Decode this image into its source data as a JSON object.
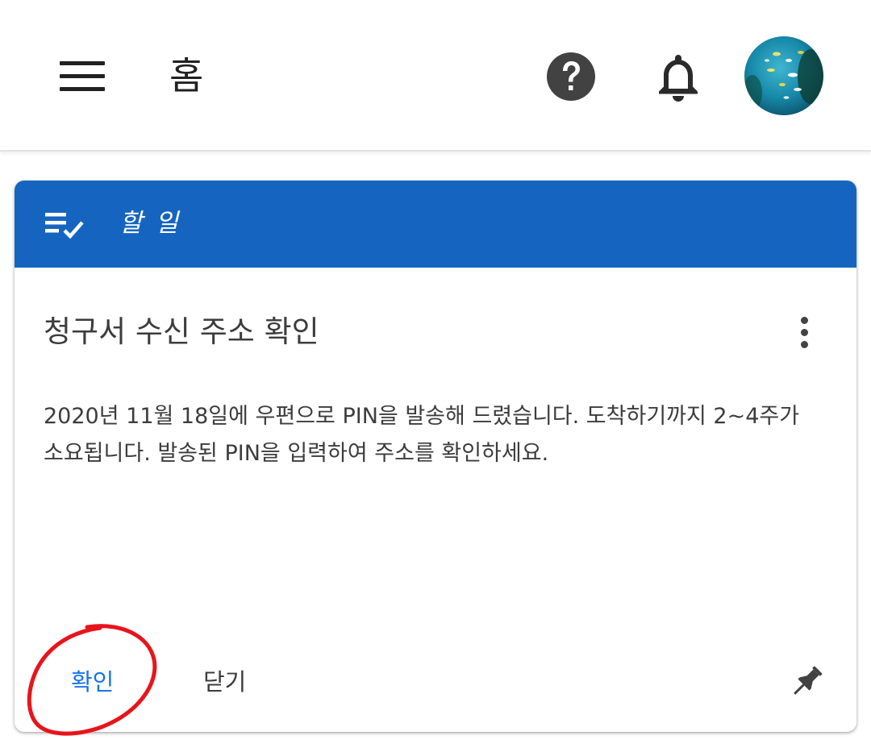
{
  "header": {
    "title": "홈",
    "icons": {
      "menu": "menu-icon",
      "help": "help-circle-icon",
      "notifications": "bell-icon",
      "avatar": "profile-avatar"
    }
  },
  "card": {
    "header_label": "할 일",
    "header_icon": "playlist-check-icon",
    "title": "청구서 수신 주소 확인",
    "body": "2020년 11월 18일에 우편으로 PIN을 발송해 드렸습니다. 도착하기까지 2~4주가 소요됩니다. 발송된 PIN을 입력하여 주소를 확인하세요.",
    "actions": {
      "confirm": "확인",
      "close": "닫기"
    },
    "more_icon": "more-vert-icon",
    "pin_icon": "pin-icon"
  },
  "colors": {
    "header_blue": "#1565c0",
    "link_blue": "#1a73e8",
    "annotation_red": "#e8141c",
    "text_dark": "#3c3c3c"
  }
}
